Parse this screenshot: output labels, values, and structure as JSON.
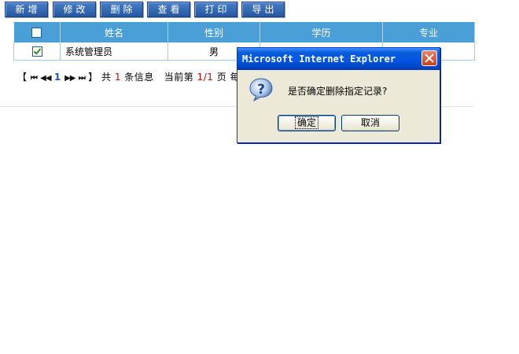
{
  "toolbar": {
    "add": "新增",
    "edit": "修改",
    "delete": "删除",
    "view": "查看",
    "print": "打印",
    "export": "导出"
  },
  "table": {
    "headers": [
      "姓名",
      "性别",
      "学历",
      "专业"
    ],
    "rows": [
      {
        "checked": true,
        "name": "系统管理员",
        "gender": "男",
        "education": "",
        "major": ""
      }
    ]
  },
  "pager": {
    "first_icon": "⏮",
    "prev_icon": "◀◀",
    "page_link": "1",
    "next_icon": "▶▶",
    "last_icon": "⏭",
    "open_bracket": "【",
    "close_bracket": "】",
    "total_prefix": "共",
    "total_count": "1",
    "total_suffix": "条信息",
    "current_label": "当前第",
    "current_page": "1/1",
    "page_suffix": "页",
    "per_page_fragment": "每页"
  },
  "dialog": {
    "title": "Microsoft Internet Explorer",
    "message": "是否确定删除指定记录?",
    "ok_label": "确定",
    "cancel_label": "取消",
    "icon": "question-icon"
  }
}
